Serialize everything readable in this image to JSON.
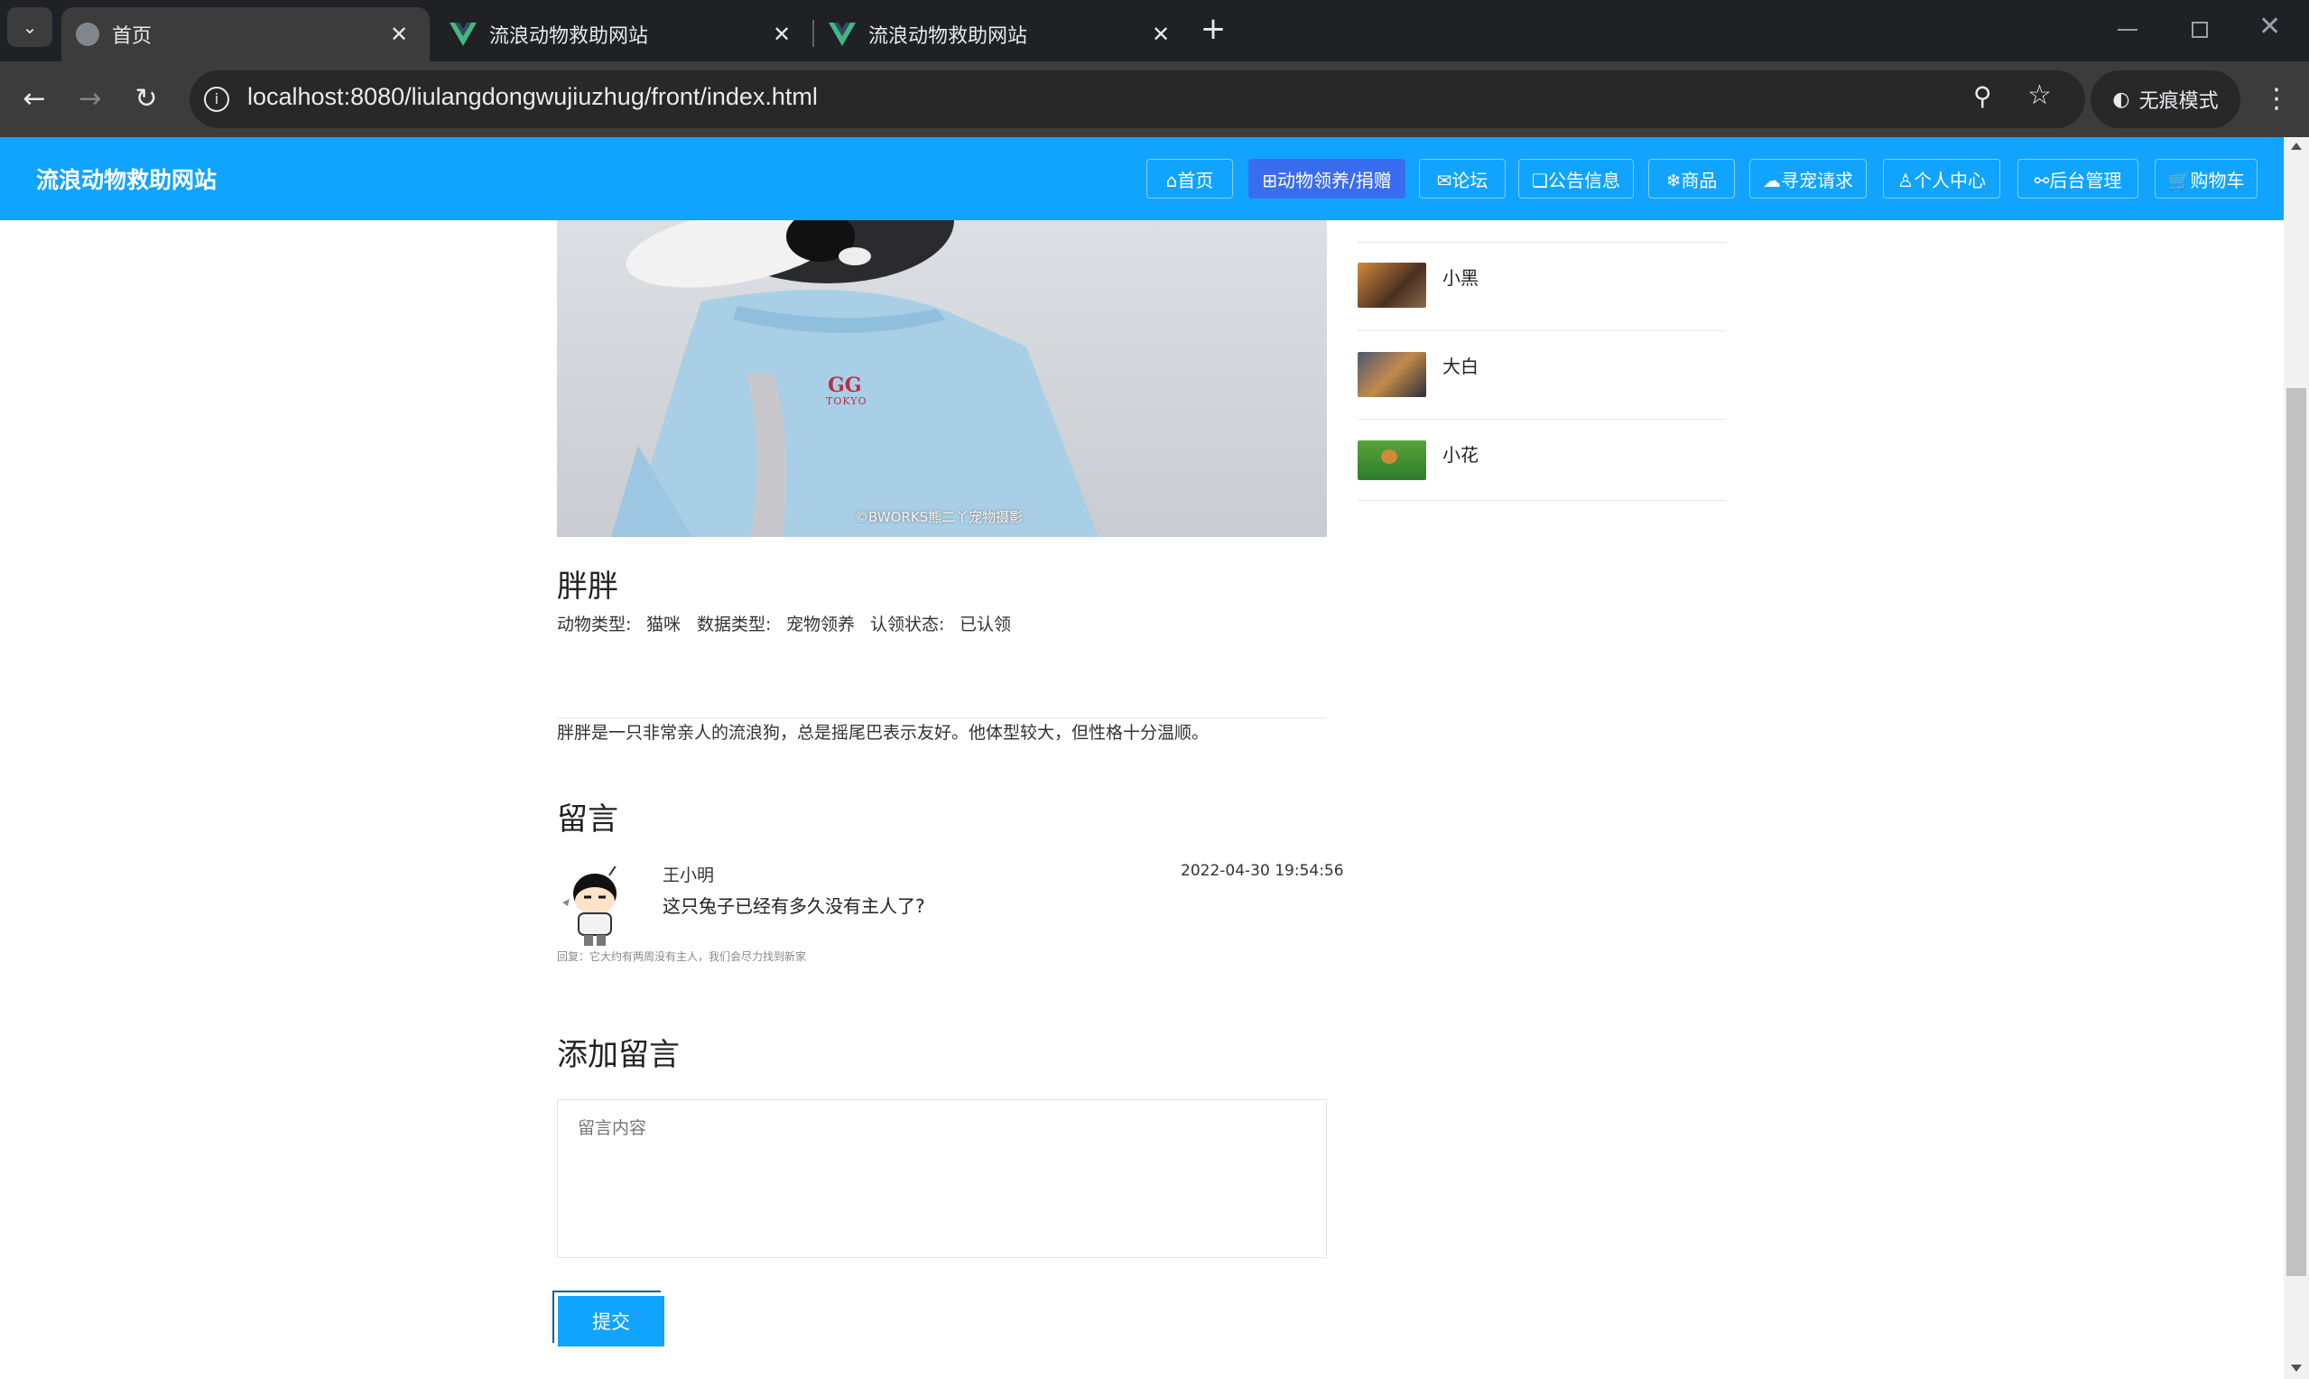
{
  "browser": {
    "tabs": [
      {
        "label": "首页"
      },
      {
        "label": "流浪动物救助网站"
      },
      {
        "label": "流浪动物救助网站"
      }
    ],
    "new_tab": "+",
    "url": "localhost:8080/liulangdongwujiuzhug/front/index.html",
    "incognito_label": "无痕模式",
    "tab_close": "✕"
  },
  "site": {
    "title": "流浪动物救助网站",
    "nav": [
      {
        "label": "⌂首页"
      },
      {
        "label": "⊞动物领养/捐赠"
      },
      {
        "label": "✉论坛"
      },
      {
        "label": "❏公告信息"
      },
      {
        "label": "❄商品"
      },
      {
        "label": "☁寻宠请求"
      },
      {
        "label": "♙个人中心"
      },
      {
        "label": "⚯后台管理"
      },
      {
        "label": "🛒购物车"
      }
    ]
  },
  "photo": {
    "shirt_text_1": "GG",
    "shirt_text_2": "TOKYO",
    "watermark": "©BWORKS熊二丫宠物摄影"
  },
  "sidebar": {
    "items": [
      {
        "name": "小黑"
      },
      {
        "name": "大白"
      },
      {
        "name": "小花"
      }
    ]
  },
  "detail": {
    "name": "胖胖",
    "type_label": "动物类型:",
    "type_value": "猫咪",
    "data_label": "数据类型:",
    "data_value": "宠物领养",
    "status_label": "认领状态:",
    "status_value": "已认领",
    "description": "胖胖是一只非常亲人的流浪狗，总是摇尾巴表示友好。他体型较大，但性格十分温顺。"
  },
  "comments": {
    "title": "留言",
    "items": [
      {
        "user": "王小明",
        "time": "2022-04-30 19:54:56",
        "text": "这只兔子已经有多久没有主人了?",
        "reply": "回复：它大约有两周没有主人，我们会尽力找到新家"
      }
    ]
  },
  "add_comment": {
    "title": "添加留言",
    "placeholder": "留言内容",
    "submit_label": "提交"
  },
  "colors": {
    "header": "#10a4ff",
    "active_nav": "#3a6cf0"
  }
}
